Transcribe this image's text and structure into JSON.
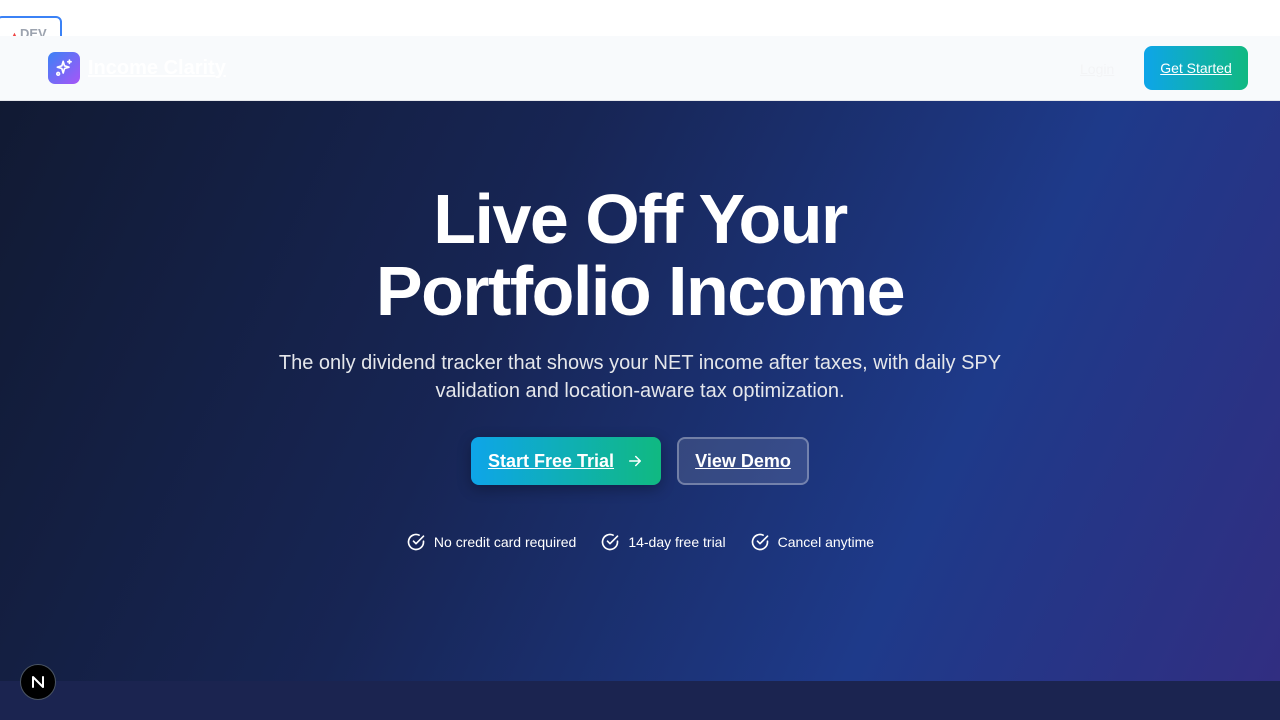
{
  "dev_badge": {
    "label": "DEV"
  },
  "nav": {
    "brand": "Income Clarity",
    "login_label": "Login",
    "cta_label": "Get Started"
  },
  "hero": {
    "title_line1": "Live Off Your",
    "title_line2": "Portfolio Income",
    "subtitle": "The only dividend tracker that shows your NET income after taxes, with daily SPY validation and location-aware tax optimization.",
    "primary_cta": "Start Free Trial",
    "secondary_cta": "View Demo",
    "features": [
      "No credit card required",
      "14-day free trial",
      "Cancel anytime"
    ]
  },
  "next_badge": {
    "label": "N"
  },
  "icons": {
    "logo": "sparkles-icon",
    "cta_arrow": "arrow-right-icon",
    "feature": "check-circle-icon"
  },
  "colors": {
    "brand_gradient_start": "#0ea5e9",
    "brand_gradient_end": "#10b981",
    "hero_bg_start": "#111a33",
    "hero_bg_end": "#312e81",
    "logo_gradient_start": "#3b82f6",
    "logo_gradient_end": "#a855f7"
  }
}
